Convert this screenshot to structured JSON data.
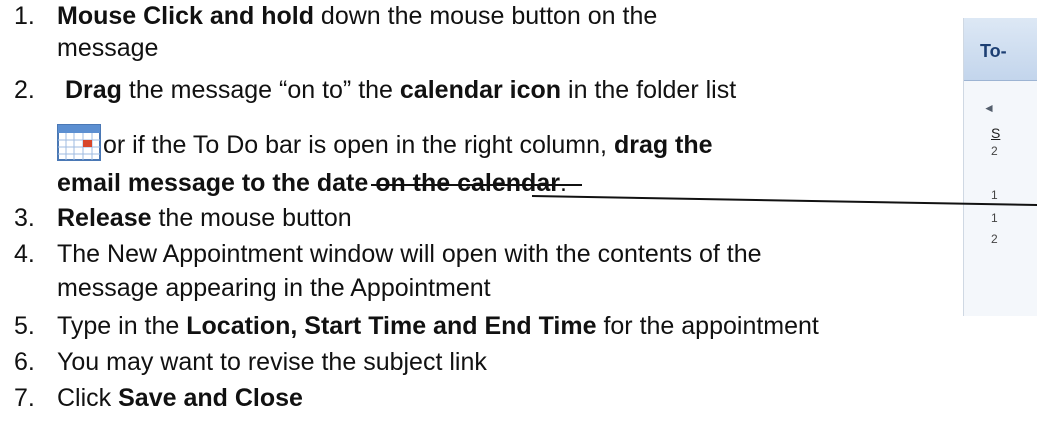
{
  "steps": [
    {
      "num": "1.",
      "bold": "Mouse Click and hold",
      "rest": " down the mouse button on the",
      "line2": "message"
    },
    {
      "num": "2.",
      "bold": "Drag",
      "rest_a": " the message “on to” the ",
      "bold_b": "calendar icon",
      "rest_b": " in the folder list",
      "line2_a": " or if the To Do bar is open in the right column, ",
      "line2_bold": "drag the",
      "line3_bold_a": "email message to the date ",
      "line3_strike": "on the calendar",
      "line3_end": "."
    },
    {
      "num": "3.",
      "bold": "Release",
      "rest": " the mouse button"
    },
    {
      "num": "4.",
      "rest": "The New Appointment window will open with the contents of the",
      "line2": "message appearing in the Appointment"
    },
    {
      "num": "5.",
      "rest_a": "Type in the ",
      "bold": "Location, Start Time and End Time",
      "rest_b": " for the appointment"
    },
    {
      "num": "6.",
      "rest": "You may want to revise the subject link"
    },
    {
      "num": "7.",
      "rest": "Click ",
      "bold": "Save and Close"
    }
  ],
  "todo_bar": {
    "title": "To-",
    "arrow": "◄",
    "day_header": "S",
    "numbers": [
      "2",
      "1",
      "1",
      "2"
    ]
  },
  "colors": {
    "text": "#111111",
    "todo_title": "#1d3f73",
    "calendar_accent": "#d9472b"
  },
  "icons": {
    "calendar": "calendar-icon"
  }
}
